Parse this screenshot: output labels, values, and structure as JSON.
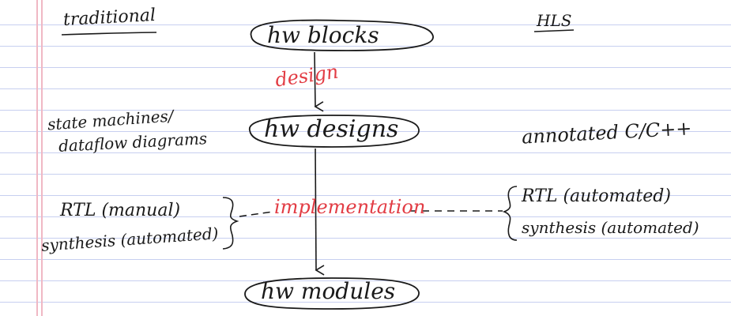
{
  "columns": {
    "traditional": "traditional",
    "hls": "HLS"
  },
  "flow": {
    "nodes": [
      "hw blocks",
      "hw designs",
      "hw modules"
    ],
    "edges": [
      "design",
      "implementation"
    ]
  },
  "traditional_notes": {
    "line1": "state machines/",
    "line2": "dataflow diagrams",
    "rtl": "RTL (manual)",
    "synthesis": "synthesis (automated)"
  },
  "hls_notes": {
    "annotated": "annotated C/C++",
    "rtl": "RTL (automated)",
    "synthesis": "synthesis (automated)"
  },
  "colors": {
    "ink": "#1a1a1a",
    "red_ink": "#e23c44",
    "ruled_line": "#c7cff0",
    "margin_line": "#f0b8c4"
  }
}
